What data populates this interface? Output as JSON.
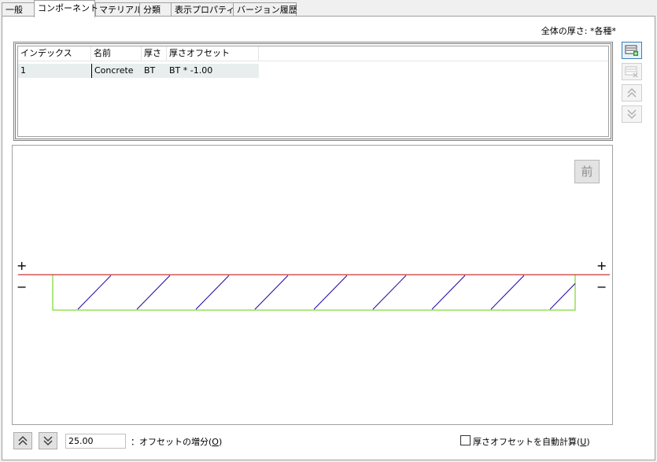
{
  "tabs": [
    {
      "label": "一般"
    },
    {
      "label": "コンポーネント"
    },
    {
      "label": "マテリアル"
    },
    {
      "label": "分類"
    },
    {
      "label": "表示プロパティ"
    },
    {
      "label": "バージョン履歴"
    }
  ],
  "active_tab": 1,
  "total_thickness": {
    "label": "全体の厚さ:",
    "value": "*各種*"
  },
  "table": {
    "columns": [
      "インデックス",
      "名前",
      "厚さ",
      "厚さオフセット"
    ],
    "rows": [
      {
        "index": "1",
        "name": "Concrete",
        "thickness": "BT",
        "offset": "BT * -1.00"
      }
    ]
  },
  "side_buttons": [
    {
      "name": "add-component-button",
      "icon": "add-component-icon",
      "enabled": true
    },
    {
      "name": "remove-component-button",
      "icon": "remove-component-icon",
      "enabled": false
    },
    {
      "name": "move-up-button",
      "icon": "double-chevron-up-icon",
      "enabled": false
    },
    {
      "name": "move-down-button",
      "icon": "double-chevron-down-icon",
      "enabled": false
    }
  ],
  "preview": {
    "view_button": "前",
    "plus": "+",
    "minus": "−",
    "baseline_color": "#c00000",
    "component_outline_color": "#66cc00",
    "hatch_color": "#2000a0"
  },
  "bottom": {
    "offset_increment_value": "25.00",
    "offset_increment_label_prefix": "：オフセットの増分(",
    "offset_increment_mnemonic": "O",
    "label_suffix": ")",
    "auto_calc_label_prefix": "厚さオフセットを自動計算(",
    "auto_calc_mnemonic": "U",
    "auto_calc_checked": false
  }
}
